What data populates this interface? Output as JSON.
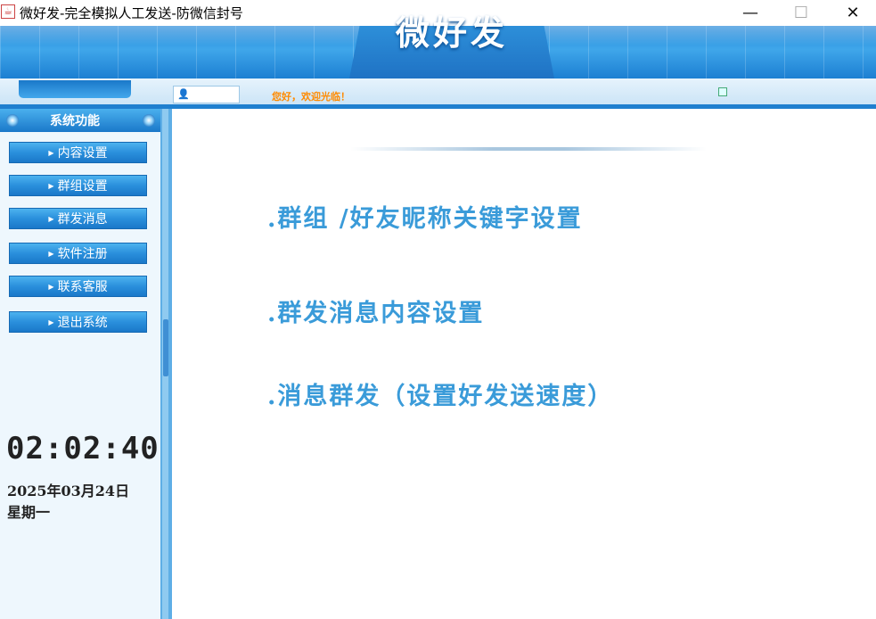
{
  "window": {
    "title": "微好发-完全模拟人工发送-防微信封号",
    "min_icon": "minimize-icon",
    "max_icon": "maximize-icon",
    "close_icon": "close-icon"
  },
  "banner": {
    "title": "微好发"
  },
  "subbar": {
    "welcome": "您好，欢迎光临！"
  },
  "sidebar": {
    "header": "系统功能",
    "items": [
      {
        "label": "内容设置"
      },
      {
        "label": "群组设置"
      },
      {
        "label": "群发消息"
      },
      {
        "label": "软件注册"
      },
      {
        "label": "联系客服"
      },
      {
        "label": "退出系统"
      }
    ],
    "clock": "02:02:40",
    "date": "2025年03月24日",
    "weekday": "星期一"
  },
  "main": {
    "items": [
      {
        "label": ".群组 /好友昵称关键字设置"
      },
      {
        "label": ".群发消息内容设置"
      },
      {
        "label": ".消息群发（设置好发送速度）"
      }
    ]
  },
  "colors": {
    "accent": "#1f86d8",
    "main_text": "#3a9bd9",
    "welcome": "#ff8a00"
  }
}
